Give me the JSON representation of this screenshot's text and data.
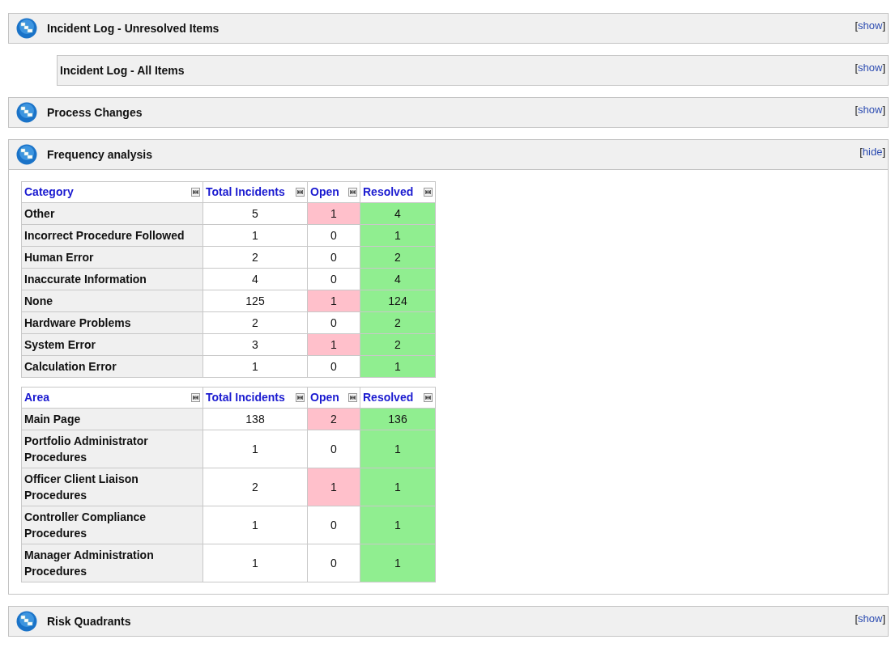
{
  "bracket_open": "[",
  "bracket_close": "]",
  "sections": [
    {
      "title": "Incident Log - Unresolved Items",
      "icon": true,
      "indented": false,
      "expanded": false,
      "toggle": "show"
    },
    {
      "title": "Incident Log - All Items",
      "icon": false,
      "indented": true,
      "expanded": false,
      "toggle": "show"
    },
    {
      "title": "Process Changes",
      "icon": true,
      "indented": false,
      "expanded": false,
      "toggle": "show"
    },
    {
      "title": "Frequency analysis",
      "icon": true,
      "indented": false,
      "expanded": true,
      "toggle": "hide",
      "tables": [
        {
          "columns": [
            {
              "label": "Category",
              "kind": "label"
            },
            {
              "label": "Total Incidents",
              "kind": "total"
            },
            {
              "label": "Open",
              "kind": "open"
            },
            {
              "label": "Resolved",
              "kind": "resolved"
            }
          ],
          "rows": [
            {
              "label": "Other",
              "total": "5",
              "open": {
                "value": "1",
                "flag": true
              },
              "resolved": "4"
            },
            {
              "label": "Incorrect Procedure Followed",
              "total": "1",
              "open": {
                "value": "0",
                "flag": false
              },
              "resolved": "1"
            },
            {
              "label": "Human Error",
              "total": "2",
              "open": {
                "value": "0",
                "flag": false
              },
              "resolved": "2"
            },
            {
              "label": "Inaccurate Information",
              "total": "4",
              "open": {
                "value": "0",
                "flag": false
              },
              "resolved": "4"
            },
            {
              "label": "None",
              "total": "125",
              "open": {
                "value": "1",
                "flag": true
              },
              "resolved": "124"
            },
            {
              "label": "Hardware Problems",
              "total": "2",
              "open": {
                "value": "0",
                "flag": false
              },
              "resolved": "2"
            },
            {
              "label": "System Error",
              "total": "3",
              "open": {
                "value": "1",
                "flag": true
              },
              "resolved": "2"
            },
            {
              "label": "Calculation Error",
              "total": "1",
              "open": {
                "value": "0",
                "flag": false
              },
              "resolved": "1"
            }
          ]
        },
        {
          "columns": [
            {
              "label": "Area",
              "kind": "label"
            },
            {
              "label": "Total Incidents",
              "kind": "total"
            },
            {
              "label": "Open",
              "kind": "open"
            },
            {
              "label": "Resolved",
              "kind": "resolved"
            }
          ],
          "rows": [
            {
              "label": "Main Page",
              "total": "138",
              "open": {
                "value": "2",
                "flag": true
              },
              "resolved": "136"
            },
            {
              "label": "Portfolio Administrator Procedures",
              "total": "1",
              "open": {
                "value": "0",
                "flag": false
              },
              "resolved": "1"
            },
            {
              "label": "Officer Client Liaison Procedures",
              "total": "2",
              "open": {
                "value": "1",
                "flag": true
              },
              "resolved": "1"
            },
            {
              "label": "Controller Compliance Procedures",
              "total": "1",
              "open": {
                "value": "0",
                "flag": false
              },
              "resolved": "1"
            },
            {
              "label": "Manager Administration Procedures",
              "total": "1",
              "open": {
                "value": "0",
                "flag": false
              },
              "resolved": "1"
            }
          ]
        }
      ]
    },
    {
      "title": "Risk Quadrants",
      "icon": true,
      "indented": false,
      "expanded": false,
      "toggle": "show"
    }
  ]
}
